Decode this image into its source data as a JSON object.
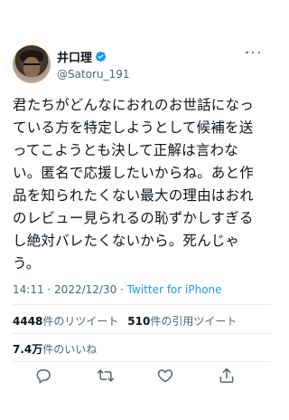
{
  "user": {
    "name": "井口理",
    "handle": "@Satoru_191"
  },
  "tweet": {
    "lines": [
      "君たちがどんなにおれのお世話になっ",
      "ている方を特定しようとして候補を送",
      "ってこようとも決して正解は言わな",
      "い。匿名で応援したいからね。あと作",
      "品を知られたくない最大の理由はおれ",
      "のレビュー見られるの恥ずかしすぎる",
      "し絶対バレたくないから。死んじゃ",
      "う。"
    ]
  },
  "meta": {
    "time": "14:11",
    "sep": " · ",
    "date": "2022/12/30",
    "source": "Twitter for iPhone"
  },
  "stats": {
    "retweets": "4448",
    "retweets_label": "件のリツイート",
    "quotes": "510",
    "quotes_label": "件の引用ツイート",
    "likes": "7.4万",
    "likes_label": "件のいいね"
  },
  "icons": {
    "verified": "verified-badge-icon",
    "reply": "reply-icon",
    "retweet": "retweet-icon",
    "like": "heart-icon",
    "share": "share-icon"
  },
  "colors": {
    "accent": "#1d9bf0",
    "text": "#0f1419",
    "muted": "#536471"
  }
}
